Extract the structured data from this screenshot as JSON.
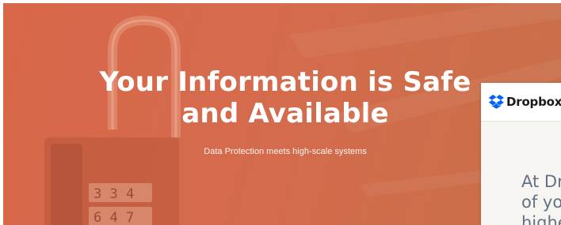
{
  "hero": {
    "title_line1": "Your Information is Safe",
    "title_line2": "and Available",
    "subtitle": "Data Protection meets high-scale systems",
    "overlay_color": "#d9674a"
  },
  "popup": {
    "brand": "Dropbox",
    "brand_color": "#0061fe",
    "body_lines": [
      "At Dr",
      "of you",
      "highe"
    ]
  },
  "icons": {
    "padlock": "padlock-image",
    "logo": "dropbox-logo-icon"
  }
}
